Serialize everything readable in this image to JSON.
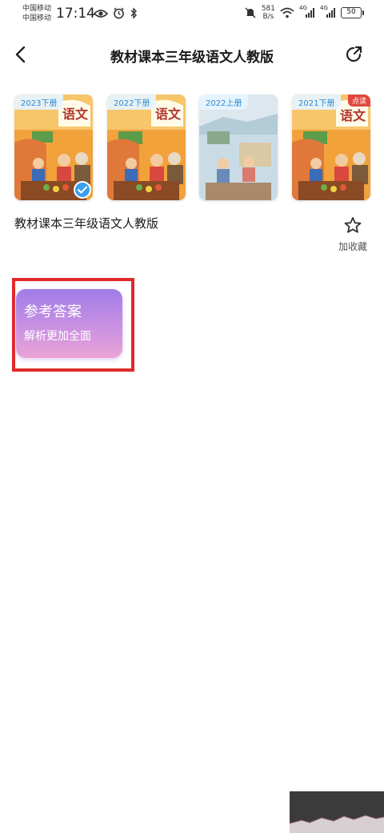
{
  "status_bar": {
    "carrier1": "中国移动",
    "carrier2": "中国移动",
    "time": "17:14",
    "net_speed_value": "581",
    "net_speed_unit": "B/s",
    "signal1_tag": "4G",
    "signal2_tag": "4G",
    "battery": "50",
    "icons": [
      "eye-icon",
      "alarm-icon",
      "bluetooth-icon",
      "mute-icon",
      "wifi-icon",
      "signal-icon",
      "battery-icon"
    ]
  },
  "header": {
    "title": "教材课本三年级语文人教版",
    "back_icon": "chevron-left-icon",
    "share_icon": "share-icon"
  },
  "books": [
    {
      "year": "2023下册",
      "selected": true,
      "tag": ""
    },
    {
      "year": "2022下册",
      "selected": false,
      "tag": ""
    },
    {
      "year": "2022上册",
      "selected": false,
      "tag": ""
    },
    {
      "year": "2021下册",
      "selected": false,
      "tag": "点读"
    }
  ],
  "book_info": {
    "name": "教材课本三年级语文人教版",
    "favorite_label": "加收藏"
  },
  "answer_card": {
    "title": "参考答案",
    "subtitle": "解析更加全面"
  },
  "colors": {
    "accent_blue": "#3aa0ee",
    "highlight_red": "#e02a2a",
    "card_gradient_top": "#a07ce8",
    "card_gradient_bottom": "#eba3d6"
  }
}
